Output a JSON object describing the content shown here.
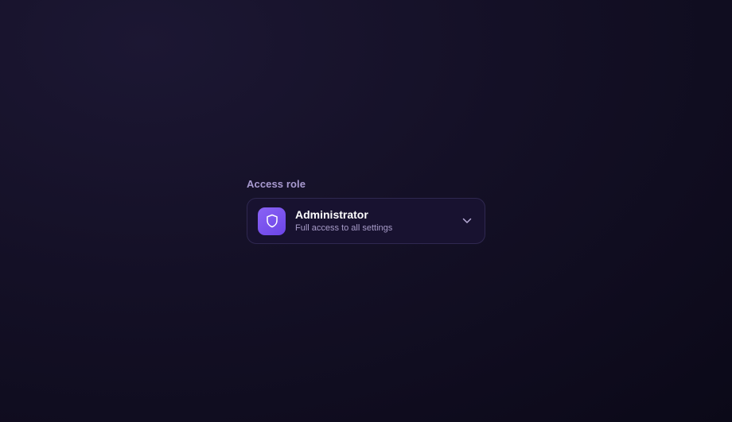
{
  "field": {
    "label": "Access role",
    "selected": {
      "title": "Administrator",
      "description": "Full access to all settings",
      "icon": "shield-icon"
    },
    "toggle_icon": "chevron-down-icon"
  },
  "colors": {
    "accent": "#7c55f0",
    "label": "#a99bd1",
    "surface": "#181230",
    "border": "#2f2850"
  }
}
